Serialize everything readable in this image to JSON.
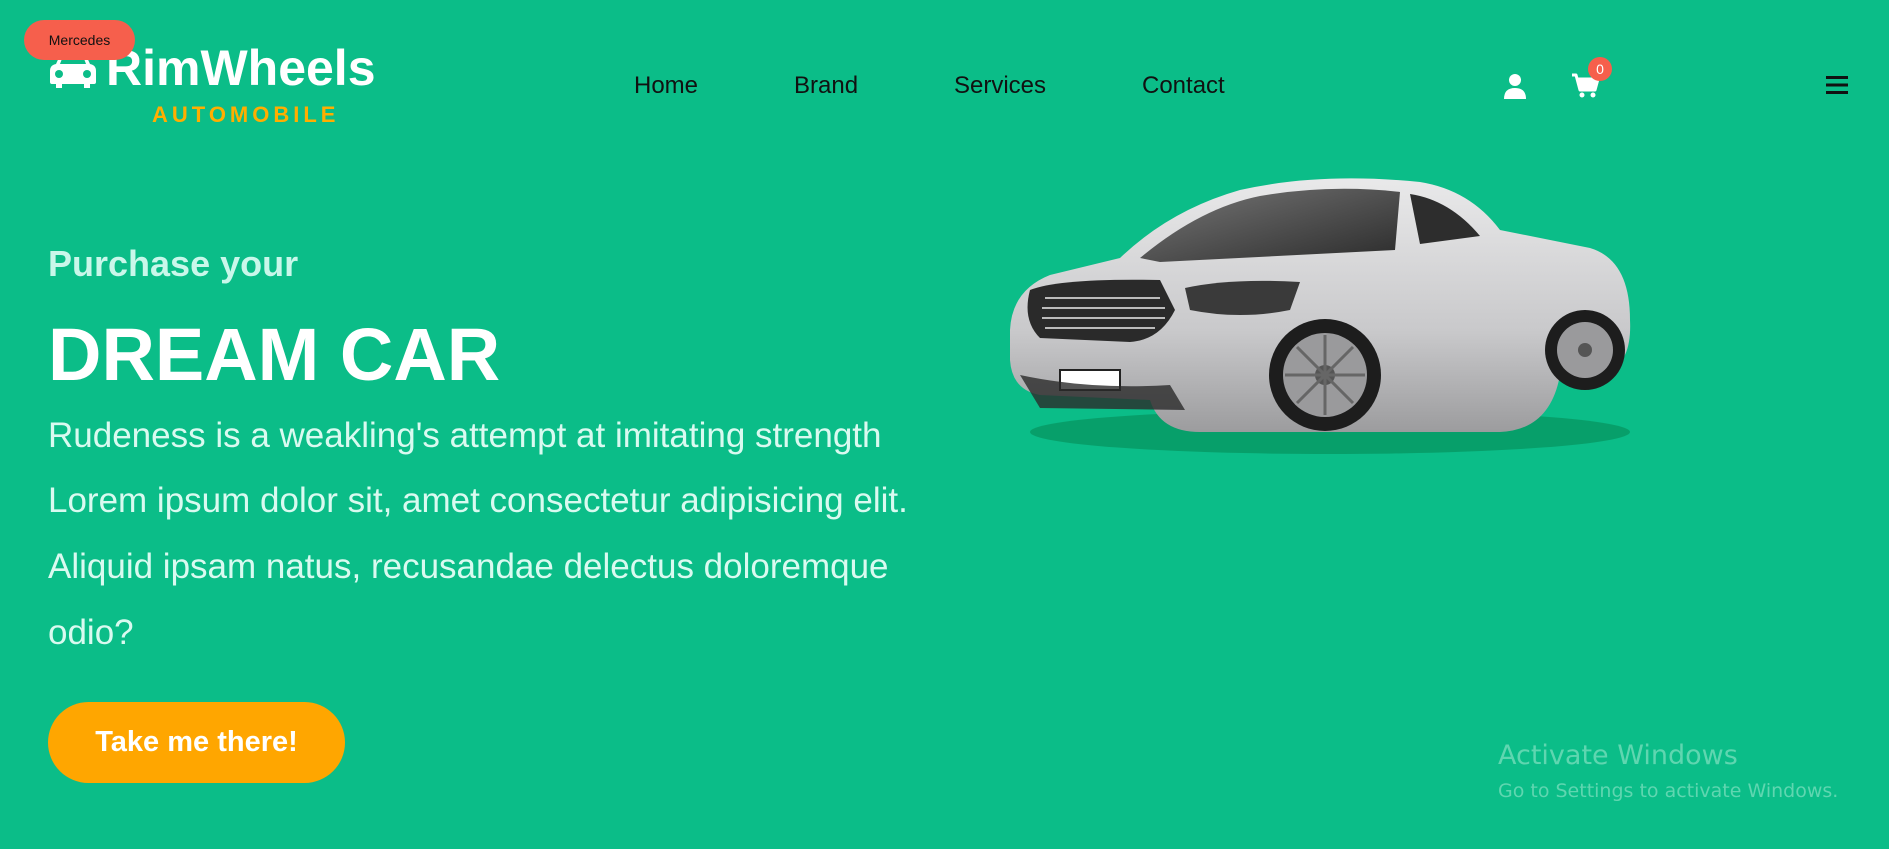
{
  "badge": {
    "label": "Mercedes"
  },
  "logo": {
    "title": "RimWheels",
    "subtitle": "AUTOMOBILE",
    "icon": "car-icon"
  },
  "nav": {
    "items": [
      "Home",
      "Brand",
      "Services",
      "Contact"
    ]
  },
  "header_actions": {
    "user_icon": "user-icon",
    "cart_icon": "cart-icon",
    "cart_count": "0",
    "menu_icon": "hamburger-menu-icon"
  },
  "hero": {
    "kicker": "Purchase your",
    "title": "DREAM CAR",
    "tagline": "Rudeness is a weakling's attempt at imitating strength",
    "description": "Lorem ipsum dolor sit, amet consectetur adipisicing elit. Aliquid ipsam natus, recusandae delectus doloremque odio?",
    "cta_label": "Take me there!"
  },
  "watermark": {
    "title": "Activate Windows",
    "subtitle": "Go to Settings to activate Windows."
  },
  "colors": {
    "background": "#0bbd88",
    "accent": "#ffa600",
    "badge": "#f65f4c",
    "white": "#ffffff"
  }
}
